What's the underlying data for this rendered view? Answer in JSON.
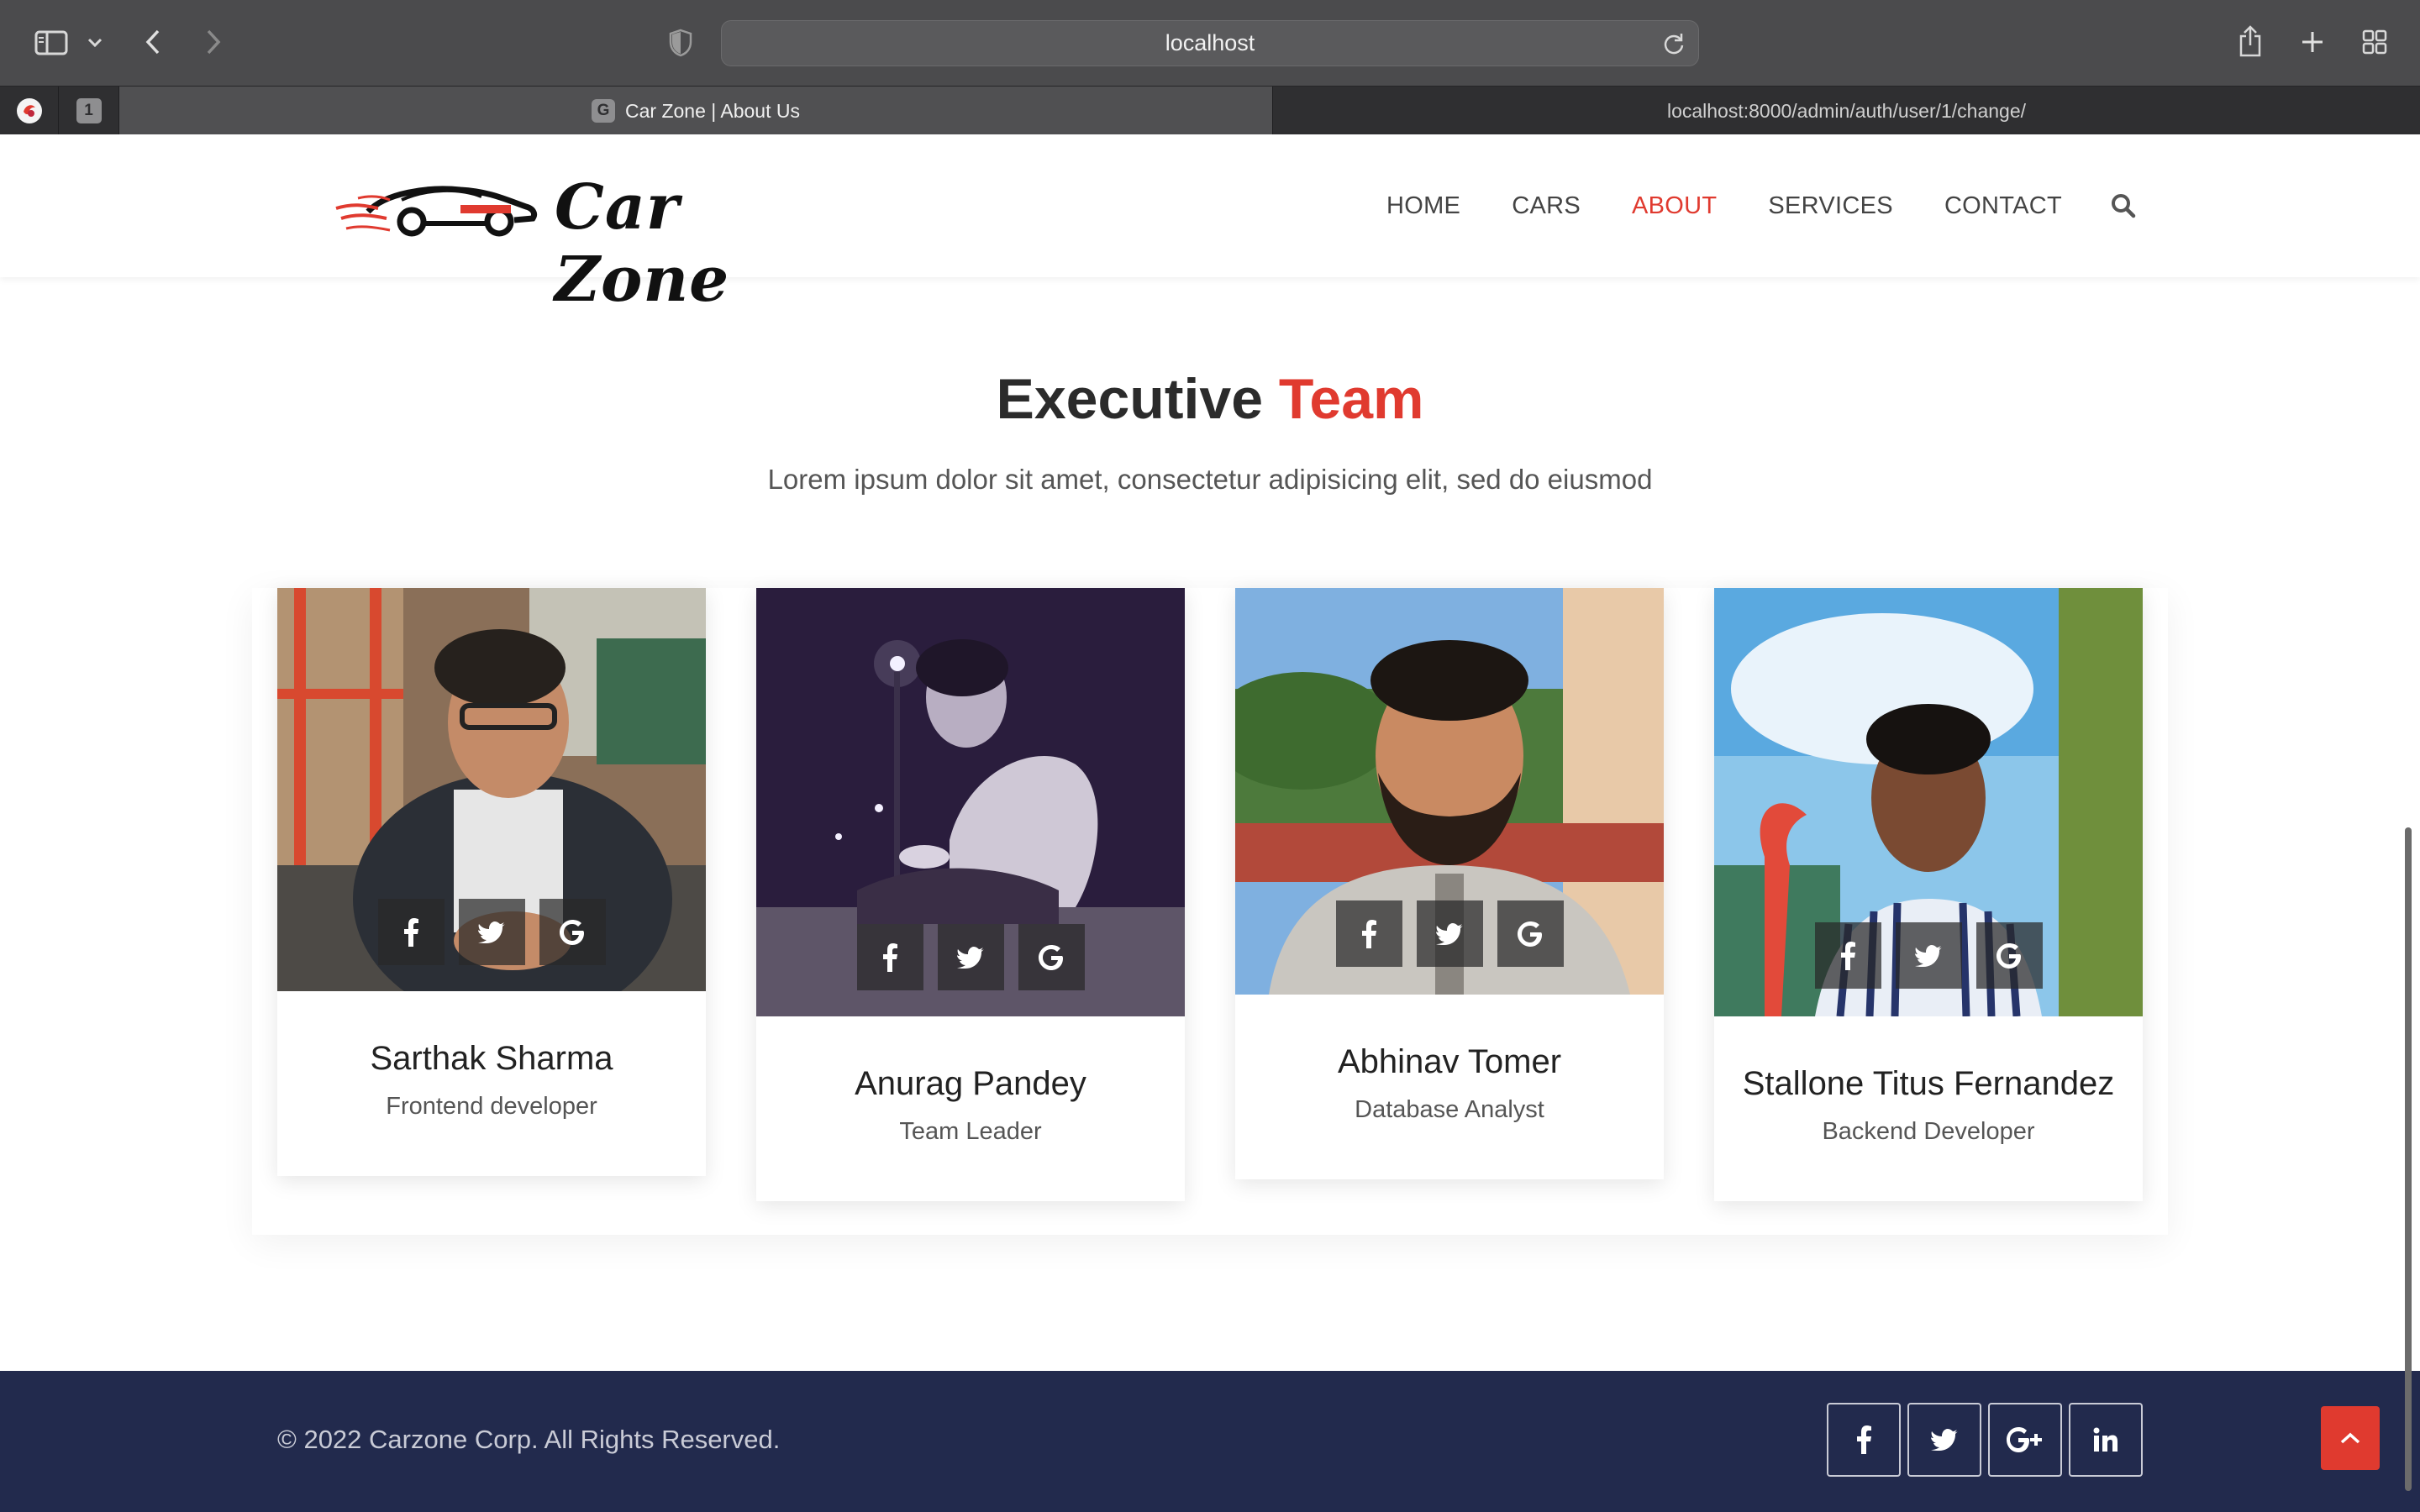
{
  "browser": {
    "address": "localhost",
    "tabs": [
      {
        "label": "Car Zone | About Us",
        "favicon": "G"
      },
      {
        "label": "localhost:8000/admin/auth/user/1/change/"
      }
    ],
    "pinned_tab_label": "1"
  },
  "site": {
    "logo_text": "Car Zone",
    "nav": [
      {
        "label": "HOME"
      },
      {
        "label": "CARS"
      },
      {
        "label": "ABOUT"
      },
      {
        "label": "SERVICES"
      },
      {
        "label": "CONTACT"
      }
    ],
    "active_nav": "ABOUT",
    "accent_color": "#e03a2f"
  },
  "team_section": {
    "title_main": "Executive",
    "title_accent": "Team",
    "subtitle": "Lorem ipsum dolor sit amet, consectetur adipisicing elit, sed do eiusmod",
    "members": [
      {
        "name": "Sarthak Sharma",
        "role": "Frontend developer",
        "socials": [
          "facebook-icon",
          "twitter-icon",
          "google-icon"
        ]
      },
      {
        "name": "Anurag Pandey",
        "role": "Team Leader",
        "socials": [
          "facebook-icon",
          "twitter-icon",
          "google-icon"
        ]
      },
      {
        "name": "Abhinav Tomer",
        "role": "Database Analyst",
        "socials": [
          "facebook-icon",
          "twitter-icon",
          "google-icon"
        ]
      },
      {
        "name": "Stallone Titus Fernandez",
        "role": "Backend Developer",
        "socials": [
          "facebook-icon",
          "twitter-icon",
          "google-icon"
        ]
      }
    ]
  },
  "footer": {
    "copyright": "© 2022 Carzone Corp. All Rights Reserved.",
    "socials": [
      "facebook-icon",
      "twitter-icon",
      "google-plus-icon",
      "linkedin-icon"
    ],
    "background": "#222a4d"
  }
}
